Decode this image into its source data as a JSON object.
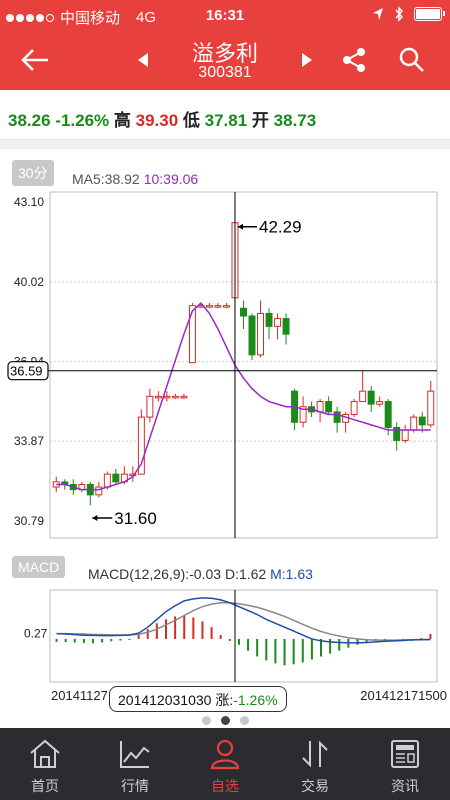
{
  "status_bar": {
    "carrier": "中国移动",
    "network": "4G",
    "time": "16:31"
  },
  "header": {
    "name": "溢多利",
    "code": "300381"
  },
  "quote": {
    "price": "38.26",
    "change": "-1.26%",
    "high_label": "高",
    "high": "39.30",
    "low_label": "低",
    "low": "37.81",
    "open_label": "开",
    "open": "38.73"
  },
  "kline_panel": {
    "period_tag": "30分",
    "ma5_text": "MA5:38.92",
    "cursor_time": "10:39.06",
    "y_ticks": [
      "43.10",
      "40.02",
      "36.94",
      "33.87",
      "30.79"
    ],
    "cursor_price": "36.59",
    "max_marker": "42.29",
    "min_marker": "31.60"
  },
  "macd_panel": {
    "tag": "MACD",
    "params_text": "MACD(12,26,9):-0.03",
    "d_text": "D:1.62",
    "m_text": "M:1.63",
    "y_tick": "0.27"
  },
  "x_axis": {
    "start": "20141127",
    "cursor_date": "201412031030",
    "cursor_change_label": "涨:",
    "cursor_change": "-1.26%",
    "end": "201412171500"
  },
  "pager": {
    "count": 3,
    "active": 1
  },
  "tabs": [
    {
      "label": "首页",
      "icon": "home-icon"
    },
    {
      "label": "行情",
      "icon": "chart-icon"
    },
    {
      "label": "自选",
      "icon": "user-icon",
      "active": true
    },
    {
      "label": "交易",
      "icon": "transfer-icon"
    },
    {
      "label": "资讯",
      "icon": "news-icon"
    }
  ],
  "colors": {
    "brand": "#e8403d",
    "up": "#d52b25",
    "down": "#1a8a1a",
    "ma_purple": "#9b27c4",
    "macd_blue": "#1c4fa5"
  },
  "chart_data": [
    {
      "type": "candlestick",
      "title": "",
      "ylim": [
        30.79,
        43.1
      ],
      "y_ticks": [
        43.1,
        40.02,
        36.94,
        33.87,
        30.79
      ],
      "series": [
        {
          "name": "MA5",
          "values": [
            32.2,
            32.2,
            32.1,
            32.0,
            32.0,
            32.0,
            32.1,
            32.2,
            32.3,
            32.5,
            33.0,
            34.0,
            35.0,
            36.0,
            37.0,
            38.0,
            38.9,
            39.2,
            38.8,
            38.2,
            37.5,
            36.8,
            36.3,
            35.9,
            35.6,
            35.4,
            35.3,
            35.2,
            35.2,
            35.1,
            35.1,
            35.0,
            34.9,
            34.9,
            34.8,
            34.7,
            34.6,
            34.5,
            34.4,
            34.3,
            34.3,
            34.3,
            34.3,
            34.3,
            34.3
          ]
        }
      ],
      "candles": [
        [
          32.1,
          32.3,
          32.5,
          31.9
        ],
        [
          32.3,
          32.2,
          32.4,
          32.0
        ],
        [
          32.2,
          32.0,
          32.4,
          31.8
        ],
        [
          32.0,
          32.2,
          32.3,
          31.9
        ],
        [
          32.2,
          31.8,
          32.3,
          31.4
        ],
        [
          31.8,
          32.1,
          32.3,
          31.7
        ],
        [
          32.1,
          32.6,
          32.7,
          32.0
        ],
        [
          32.6,
          32.3,
          32.8,
          32.2
        ],
        [
          32.3,
          32.6,
          32.9,
          32.2
        ],
        [
          32.6,
          32.6,
          32.9,
          32.3
        ],
        [
          32.6,
          34.8,
          35.1,
          32.6
        ],
        [
          34.8,
          35.6,
          35.9,
          34.6
        ],
        [
          35.6,
          35.6,
          35.8,
          35.4
        ],
        [
          35.6,
          35.6,
          35.8,
          35.4
        ],
        [
          35.6,
          35.6,
          35.7,
          35.5
        ],
        [
          35.6,
          35.6,
          35.7,
          35.5
        ],
        [
          36.9,
          39.1,
          39.2,
          36.9
        ],
        [
          39.1,
          39.1,
          39.2,
          39.0
        ],
        [
          39.1,
          39.1,
          39.2,
          39.0
        ],
        [
          39.1,
          39.1,
          39.2,
          39.0
        ],
        [
          39.1,
          39.1,
          39.2,
          39.0
        ],
        [
          39.4,
          42.3,
          42.3,
          39.2
        ],
        [
          39.0,
          38.7,
          39.3,
          38.2
        ],
        [
          38.7,
          37.2,
          38.8,
          37.0
        ],
        [
          37.2,
          38.8,
          39.3,
          37.1
        ],
        [
          38.8,
          38.3,
          39.0,
          37.8
        ],
        [
          38.3,
          38.6,
          38.8,
          37.8
        ],
        [
          38.6,
          38.0,
          38.8,
          37.6
        ],
        [
          35.8,
          34.6,
          35.9,
          34.3
        ],
        [
          34.6,
          35.2,
          35.6,
          34.4
        ],
        [
          35.2,
          35.0,
          35.4,
          34.8
        ],
        [
          35.0,
          35.4,
          35.5,
          34.6
        ],
        [
          35.4,
          35.0,
          35.6,
          34.9
        ],
        [
          35.0,
          34.6,
          35.2,
          34.2
        ],
        [
          34.6,
          34.9,
          35.0,
          34.2
        ],
        [
          34.9,
          35.4,
          35.5,
          34.8
        ],
        [
          35.4,
          35.8,
          36.6,
          35.6
        ],
        [
          35.8,
          35.3,
          36.0,
          35.0
        ],
        [
          35.3,
          35.4,
          35.6,
          35.2
        ],
        [
          35.4,
          34.4,
          35.5,
          34.1
        ],
        [
          34.4,
          33.9,
          34.6,
          33.5
        ],
        [
          33.9,
          34.3,
          34.5,
          33.8
        ],
        [
          34.3,
          34.8,
          34.9,
          34.2
        ],
        [
          34.8,
          34.5,
          35.0,
          34.2
        ],
        [
          34.5,
          35.8,
          36.2,
          34.4
        ]
      ]
    },
    {
      "type": "macd",
      "y_tick": 0.27,
      "ylim": [
        -2.0,
        2.3
      ],
      "series": [
        {
          "name": "MACD",
          "values": [
            0.27,
            0.25,
            0.22,
            0.19,
            0.18,
            0.17,
            0.17,
            0.18,
            0.2,
            0.3,
            0.6,
            1.0,
            1.4,
            1.7,
            1.95,
            2.05,
            2.1,
            2.08,
            2.0,
            1.85,
            1.65,
            1.45,
            1.25,
            1.0,
            0.8,
            0.6,
            0.4,
            0.2,
            0.0,
            -0.1,
            -0.15,
            -0.18,
            -0.2,
            -0.2,
            -0.18,
            -0.15,
            -0.12,
            -0.1,
            -0.08,
            -0.05,
            -0.04,
            -0.03
          ]
        },
        {
          "name": "DIFF",
          "values": [
            0.27,
            0.27,
            0.26,
            0.25,
            0.23,
            0.22,
            0.21,
            0.2,
            0.2,
            0.24,
            0.34,
            0.5,
            0.72,
            0.95,
            1.2,
            1.45,
            1.65,
            1.78,
            1.85,
            1.85,
            1.8,
            1.72,
            1.62,
            1.48,
            1.32,
            1.15,
            0.95,
            0.75,
            0.55,
            0.38,
            0.25,
            0.15,
            0.06,
            0.0,
            -0.04,
            -0.06,
            -0.06,
            -0.06,
            -0.05,
            -0.04,
            -0.03,
            -0.03
          ]
        }
      ],
      "histogram": [
        -0.15,
        -0.16,
        -0.18,
        -0.2,
        -0.22,
        -0.18,
        -0.12,
        -0.08,
        -0.05,
        0.2,
        0.5,
        0.8,
        1.0,
        1.15,
        1.2,
        1.1,
        0.9,
        0.6,
        0.2,
        -0.1,
        -0.3,
        -0.6,
        -0.9,
        -1.1,
        -1.25,
        -1.35,
        -1.3,
        -1.2,
        -1.05,
        -0.9,
        -0.75,
        -0.6,
        -0.45,
        -0.3,
        -0.2,
        -0.1,
        -0.05,
        0.0,
        -0.05,
        -0.1,
        0.05,
        0.25
      ]
    }
  ]
}
